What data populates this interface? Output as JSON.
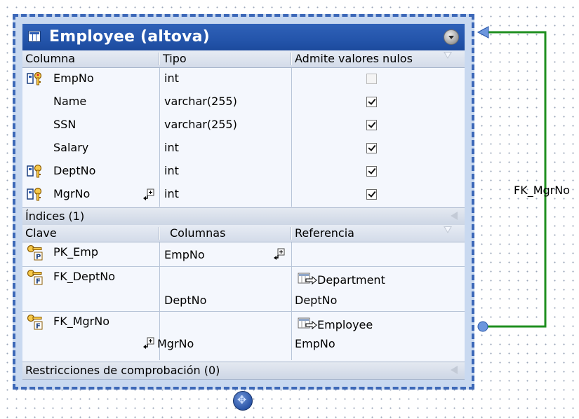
{
  "table": {
    "title": "Employee (altova)"
  },
  "columns_header": {
    "col1": "Columna",
    "col2": "Tipo",
    "col3": "Admite valores nulos"
  },
  "columns": [
    {
      "name": "EmpNo",
      "type": "int",
      "nullable": false,
      "icon": "primary-foreign-key-icon"
    },
    {
      "name": "Name",
      "type": "varchar(255)",
      "nullable": true,
      "icon": ""
    },
    {
      "name": "SSN",
      "type": "varchar(255)",
      "nullable": true,
      "icon": ""
    },
    {
      "name": "Salary",
      "type": "int",
      "nullable": true,
      "icon": ""
    },
    {
      "name": "DeptNo",
      "type": "int",
      "nullable": true,
      "icon": "foreign-key-icon"
    },
    {
      "name": "MgrNo",
      "type": "int",
      "nullable": true,
      "icon": "foreign-key-icon"
    }
  ],
  "indices": {
    "section_label": "Índices (1)",
    "header": {
      "col1": "Clave",
      "col2": "Columnas",
      "col3": "Referencia"
    },
    "keys": [
      {
        "name": "PK_Emp",
        "column": "EmpNo",
        "ref_table": "",
        "ref_column": "",
        "kind": "P"
      },
      {
        "name": "FK_DeptNo",
        "column": "DeptNo",
        "ref_table": "Department",
        "ref_column": "DeptNo",
        "kind": "F"
      },
      {
        "name": "FK_MgrNo",
        "column": "MgrNo",
        "ref_table": "Employee",
        "ref_column": "EmpNo",
        "kind": "F"
      }
    ]
  },
  "check_constraints": {
    "section_label": "Restricciones de comprobación (0)"
  },
  "relation": {
    "label": "FK_MgrNo",
    "color": "#1f8f1f"
  },
  "colors": {
    "header": "#2455ab",
    "frame_border": "#3c68b8"
  }
}
